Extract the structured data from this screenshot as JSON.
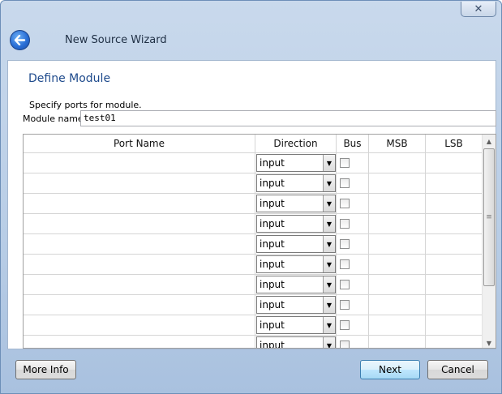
{
  "window": {
    "close_glyph": "✕",
    "title": "New Source Wizard",
    "back_glyph": "←"
  },
  "page": {
    "title": "Define Module",
    "instruction": "Specify ports for module.",
    "module_name_label": "Module name",
    "module_name_value": "test01"
  },
  "grid": {
    "columns": [
      "Port Name",
      "Direction",
      "Bus",
      "MSB",
      "LSB"
    ],
    "rows": [
      {
        "name": "",
        "direction": "input",
        "bus": false,
        "msb": "",
        "lsb": ""
      },
      {
        "name": "",
        "direction": "input",
        "bus": false,
        "msb": "",
        "lsb": ""
      },
      {
        "name": "",
        "direction": "input",
        "bus": false,
        "msb": "",
        "lsb": ""
      },
      {
        "name": "",
        "direction": "input",
        "bus": false,
        "msb": "",
        "lsb": ""
      },
      {
        "name": "",
        "direction": "input",
        "bus": false,
        "msb": "",
        "lsb": ""
      },
      {
        "name": "",
        "direction": "input",
        "bus": false,
        "msb": "",
        "lsb": ""
      },
      {
        "name": "",
        "direction": "input",
        "bus": false,
        "msb": "",
        "lsb": ""
      },
      {
        "name": "",
        "direction": "input",
        "bus": false,
        "msb": "",
        "lsb": ""
      },
      {
        "name": "",
        "direction": "input",
        "bus": false,
        "msb": "",
        "lsb": ""
      },
      {
        "name": "",
        "direction": "input",
        "bus": false,
        "msb": "",
        "lsb": ""
      }
    ]
  },
  "scrollbar": {
    "up_glyph": "▲",
    "down_glyph": "▼",
    "grip_glyph": "≡"
  },
  "dropdown_glyph": "▼",
  "footer": {
    "more_info_label": "More Info",
    "next_label": "Next",
    "cancel_label": "Cancel"
  }
}
